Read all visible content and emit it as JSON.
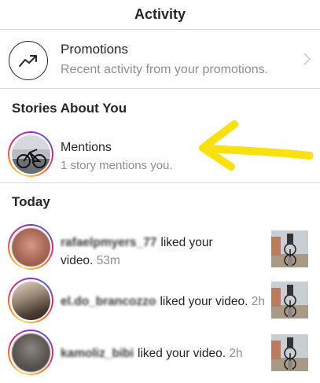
{
  "header": {
    "title": "Activity"
  },
  "promotions": {
    "icon": "trend-up-icon",
    "title": "Promotions",
    "subtitle": "Recent activity from your promotions."
  },
  "stories_section": {
    "title": "Stories About You"
  },
  "mentions": {
    "title": "Mentions",
    "subtitle": "1 story mentions you."
  },
  "today_section": {
    "title": "Today"
  },
  "activities": [
    {
      "username": "rafaelpmyers_77",
      "action": "liked your",
      "action2": "video.",
      "time": "53m"
    },
    {
      "username": "el.do_brancozzo",
      "action": "liked your video.",
      "time": "2h"
    },
    {
      "username": "kamoliz_bibi",
      "action": "liked your video.",
      "time": "2h"
    }
  ],
  "colors": {
    "annotation_arrow": "#f9e00f",
    "secondary_text": "#8e8e8e",
    "primary_text": "#262626"
  }
}
